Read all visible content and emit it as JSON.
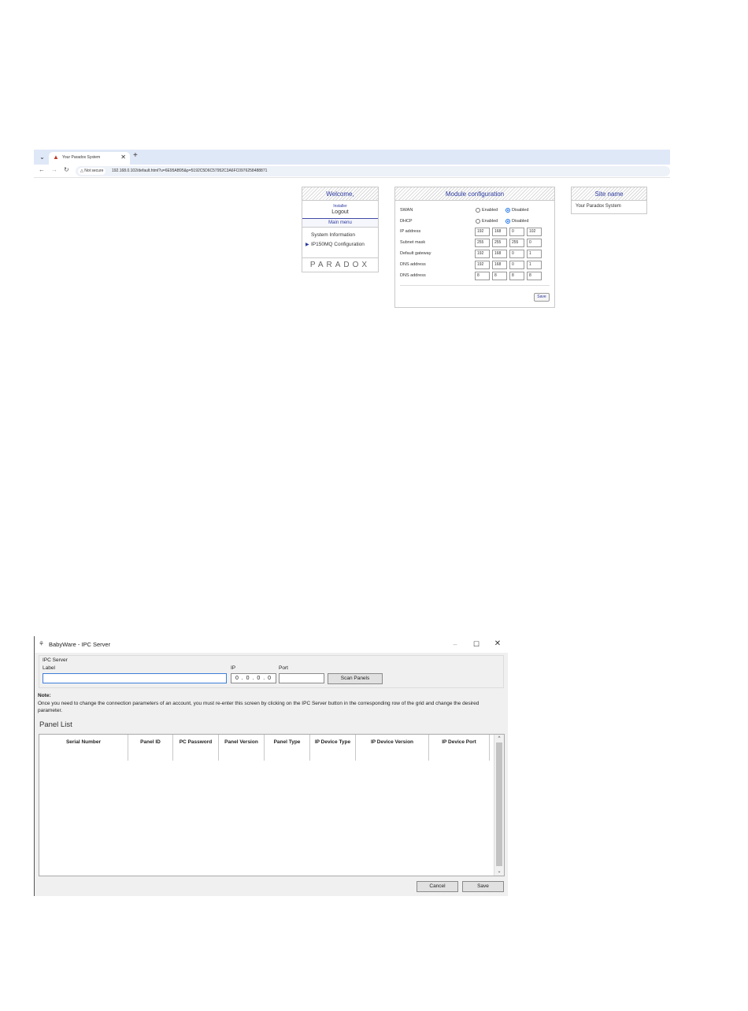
{
  "browser": {
    "tab_title": "Your Paradox System",
    "new_tab_symbol": "+",
    "security_chip": "Not secure",
    "url": "192.168.0.102/default.html?u=6E95AB95&p=5192C5D6C57952C3A6FC0976258488871",
    "welcome_panel": {
      "title": "Welcome,",
      "user_role": "Installer",
      "logout": "Logout",
      "main_menu": "Main menu",
      "items": [
        "System Information",
        "IP150MQ Configuration"
      ],
      "brand": "PARADOX"
    },
    "module_panel": {
      "title": "Module configuration",
      "rows": [
        {
          "label": "SWAN",
          "options": [
            "Enabled",
            "Disabled"
          ],
          "selected": "Disabled"
        },
        {
          "label": "DHCP",
          "options": [
            "Enabled",
            "Disabled"
          ],
          "selected": "Disabled"
        }
      ],
      "ip_rows": [
        {
          "label": "IP address",
          "octets": [
            "192",
            "168",
            "0",
            "102"
          ]
        },
        {
          "label": "Subnet mask",
          "octets": [
            "255",
            "255",
            "255",
            "0"
          ]
        },
        {
          "label": "Default gateway",
          "octets": [
            "192",
            "168",
            "0",
            "1"
          ]
        },
        {
          "label": "DNS address",
          "octets": [
            "192",
            "168",
            "0",
            "1"
          ]
        },
        {
          "label": "DNS address",
          "octets": [
            "8",
            "8",
            "8",
            "8"
          ]
        }
      ],
      "save_label": "Save"
    },
    "site_panel": {
      "title": "Site name",
      "value": "Your Paradox System"
    }
  },
  "window": {
    "title": "BabyWare - IPC Server",
    "ipc_group_title": "IPC Server",
    "label_field": {
      "label": "Label",
      "value": ""
    },
    "ip_field": {
      "label": "IP",
      "value": "0 . 0 . 0 . 0"
    },
    "port_field": {
      "label": "Port",
      "value": ""
    },
    "scan_button": "Scan Panels",
    "note_title": "Note:",
    "note_text": "Once you need to change the connection parameters of an account, you must re-enter this screen by clicking on the IPC Server button in the corresponding row of the grid and change the desired parameter.",
    "panel_list_title": "Panel List",
    "columns": [
      "Serial Number",
      "Panel ID",
      "PC Password",
      "Panel Version",
      "Panel Type",
      "IP Device Type",
      "IP Device Version",
      "IP Device Port"
    ],
    "rows": [],
    "cancel_button": "Cancel",
    "save_button": "Save"
  }
}
